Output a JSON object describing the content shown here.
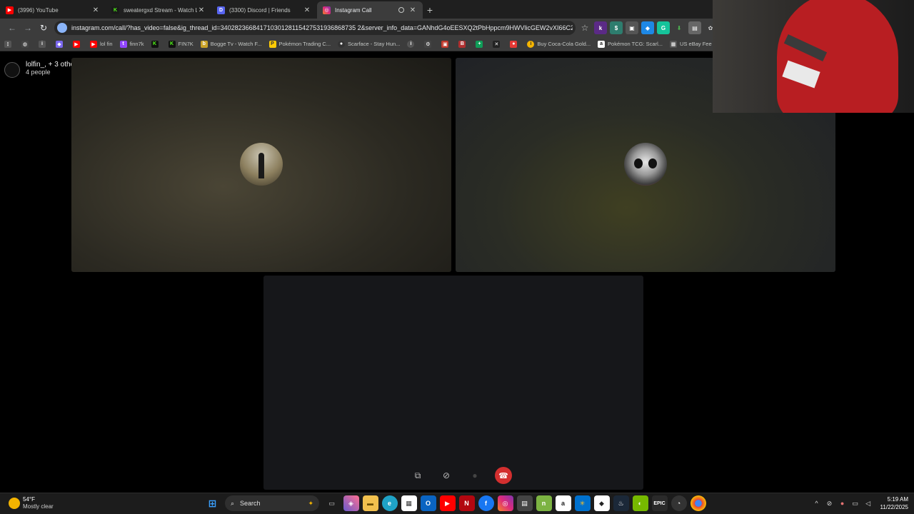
{
  "browser": {
    "tabs": [
      {
        "title": "(3996) YouTube",
        "icon": "youtube-icon",
        "color": "#ff0000",
        "active": false
      },
      {
        "title": "sweatergxd Stream - Watch Li",
        "icon": "kick-icon",
        "color": "#53fc18",
        "active": false
      },
      {
        "title": "(3300) Discord | Friends",
        "icon": "discord-icon",
        "color": "#5865f2",
        "active": false
      },
      {
        "title": "Instagram Call",
        "icon": "instagram-icon",
        "color": "#e1306c",
        "active": true
      }
    ],
    "new_tab": "+",
    "url": "instagram.com/call/?has_video=false&ig_thread_id=34028236684171030128115427531936868735 2&server_info_data=GANhdG4oEESXQ2tPbHppcm9HWVlicGEW2vXI66C2%2...",
    "bookmarks": [
      {
        "label": "",
        "icon": "apps-grid-icon",
        "color": "#888888"
      },
      {
        "label": "",
        "icon": "globe-icon",
        "color": "#666666"
      },
      {
        "label": "",
        "icon": "info-icon",
        "color": "#888888"
      },
      {
        "label": "",
        "icon": "app-icon",
        "color": "#7b68ee"
      },
      {
        "label": "",
        "icon": "youtube-icon",
        "color": "#ff0000"
      },
      {
        "label": "lol fin",
        "icon": "youtube-icon",
        "color": "#ff0000"
      },
      {
        "label": "finn7k",
        "icon": "twitch-icon",
        "color": "#9146ff"
      },
      {
        "label": "",
        "icon": "kick-icon",
        "color": "#53fc18"
      },
      {
        "label": "FIN7K",
        "icon": "kick-icon",
        "color": "#53fc18"
      },
      {
        "label": "Bogge Tv - Watch F...",
        "icon": "site-icon",
        "color": "#c9a227"
      },
      {
        "label": "Pokémon Trading C...",
        "icon": "pokemon-icon",
        "color": "#ffcb05"
      },
      {
        "label": "Scarface - Stay Hun...",
        "icon": "music-icon",
        "color": "#333333"
      },
      {
        "label": "",
        "icon": "info-icon",
        "color": "#888888"
      },
      {
        "label": "",
        "icon": "gear-icon",
        "color": "#888888"
      },
      {
        "label": "",
        "icon": "shopping-icon",
        "color": "#c0392b"
      },
      {
        "label": "",
        "icon": "bold-icon",
        "color": "#b03030"
      },
      {
        "label": "",
        "icon": "sheets-icon",
        "color": "#0f9d58"
      },
      {
        "label": "",
        "icon": "x-icon",
        "color": "#222222"
      },
      {
        "label": "",
        "icon": "location-icon",
        "color": "#e53935"
      },
      {
        "label": "Buy Coca-Cola Gold...",
        "icon": "site-icon",
        "color": "#f4b400"
      },
      {
        "label": "Pokémon TCG: Scarl...",
        "icon": "amazon-icon",
        "color": "#ffffff"
      },
      {
        "label": "US eBay Fee Calc",
        "icon": "calculator-icon",
        "color": "#555555"
      }
    ]
  },
  "call": {
    "names": "lolfin_, + 3 others",
    "count": "4 people"
  },
  "taskbar": {
    "temp": "54°F",
    "condition": "Mostly clear",
    "search_label": "Search",
    "time": "5:19 AM",
    "date": "11/22/2025"
  }
}
